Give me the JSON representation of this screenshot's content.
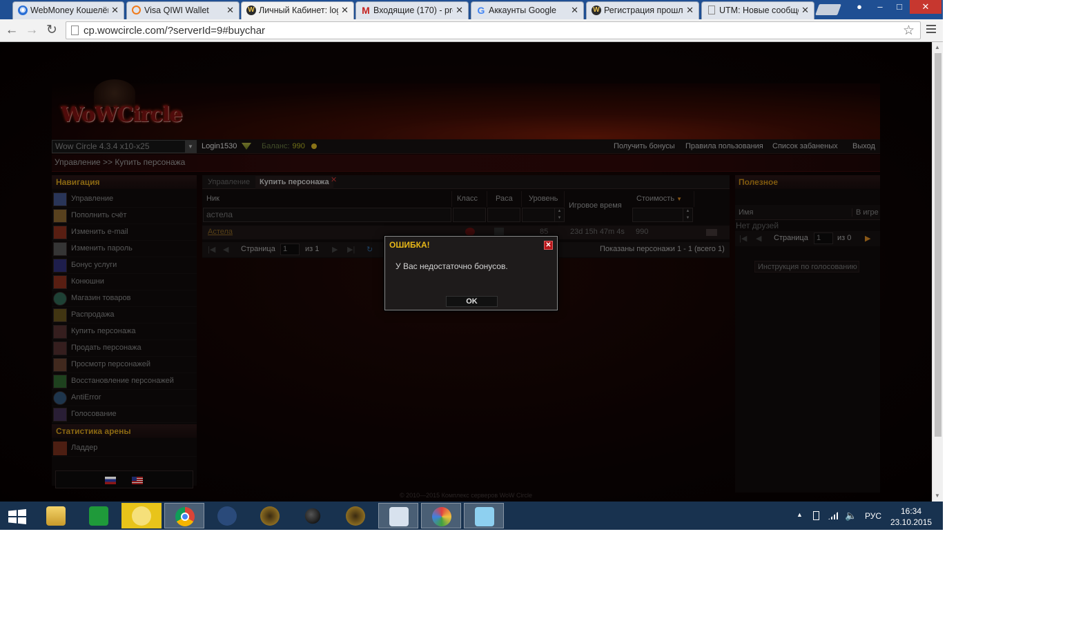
{
  "browser": {
    "tabs": [
      {
        "title": "WebMoney Кошелёк",
        "icon": "webmoney-icon",
        "color": "#2a6fd6"
      },
      {
        "title": "Visa QIWI Wallet",
        "icon": "qiwi-icon",
        "color": "#f07a1a"
      },
      {
        "title": "Личный Кабинет: log",
        "icon": "wowcircle-icon",
        "color": "#2a2a2a"
      },
      {
        "title": "Входящие (170) - pre",
        "icon": "gmail-icon",
        "color": "#c5221f"
      },
      {
        "title": "Аккаунты Google",
        "icon": "google-icon",
        "color": "#4285f4"
      },
      {
        "title": "Регистрация прошла",
        "icon": "wowcircle-icon",
        "color": "#2a2a2a"
      },
      {
        "title": "UTM: Новые сообщен",
        "icon": "page-icon",
        "color": "#888888"
      }
    ],
    "url": "cp.wowcircle.com/?serverId=9#buychar"
  },
  "site": {
    "logo": "WoWCircle",
    "server_select": "Wow Circle 4.3.4 x10-x25",
    "login": "Login1530",
    "balance_label": "Баланс:",
    "balance_value": "990",
    "top_links": [
      "Получить бонусы",
      "Правила пользования",
      "Список забаненых",
      "Выход"
    ],
    "breadcrumb": "Управление >> Купить персонажа",
    "footer": "© 2010—2015 Комплекс серверов WoW Circle"
  },
  "leftnav": {
    "nav_title": "Навигация",
    "items": [
      {
        "label": "Управление",
        "icon": "management-icon",
        "color": "#3a4a7a"
      },
      {
        "label": "Пополнить счёт",
        "icon": "deposit-icon",
        "color": "#7a5a2a"
      },
      {
        "label": "Изменить e-mail",
        "icon": "email-icon",
        "color": "#7a2a1a"
      },
      {
        "label": "Изменить пароль",
        "icon": "password-icon",
        "color": "#4a4a4a"
      },
      {
        "label": "Бонус услуги",
        "icon": "bonus-icon",
        "color": "#2a2a6a"
      },
      {
        "label": "Конюшни",
        "icon": "stable-icon",
        "color": "#7a2a1a"
      },
      {
        "label": "Магазин товаров",
        "icon": "shop-icon",
        "color": "#2a5a4a"
      },
      {
        "label": "Распродажа",
        "icon": "sale-icon",
        "color": "#5a4a1a"
      },
      {
        "label": "Купить персонажа",
        "icon": "buy-character-icon",
        "color": "#4a2a2a"
      },
      {
        "label": "Продать персонажа",
        "icon": "sell-character-icon",
        "color": "#4a2a2a"
      },
      {
        "label": "Просмотр персонажей",
        "icon": "view-characters-icon",
        "color": "#5a3a2a"
      },
      {
        "label": "Восстановление персонажей",
        "icon": "restore-characters-icon",
        "color": "#2a5a2a"
      },
      {
        "label": "AntiError",
        "icon": "antierror-icon",
        "color": "#2a4a6a"
      },
      {
        "label": "Голосование",
        "icon": "vote-icon",
        "color": "#3a2a4a"
      }
    ],
    "arena_title": "Статистика арены",
    "arena_items": [
      {
        "label": "Ладдер",
        "icon": "ladder-icon",
        "color": "#6a2a1a"
      }
    ]
  },
  "center": {
    "tab_manage": "Управление",
    "tab_buy": "Купить персонажа",
    "columns": [
      "Ник",
      "Класс",
      "Раса",
      "Уровень",
      "Игровое время",
      "Стоимость"
    ],
    "sort_indicator": "▼",
    "filter_name": "астела",
    "row": {
      "name": "Астела",
      "level": "85",
      "playtime": "23d 15h 47m 4s",
      "price": "990"
    },
    "pager": {
      "page_label": "Страница",
      "page": "1",
      "of_label": "из 1",
      "summary": "Показаны персонажи 1 - 1 (всего 1)"
    }
  },
  "right": {
    "title": "Полезное",
    "col_name": "Имя",
    "col_ingame": "В игре",
    "no_friends": "Нет друзей",
    "page_label": "Страница",
    "page": "1",
    "of_label": "из 0",
    "vote_instr": "Инструкция по голосованию"
  },
  "dialog": {
    "title": "ОШИБКА!",
    "message": "У Вас недостаточно бонусов.",
    "ok": "OK"
  },
  "taskbar": {
    "language": "РУС",
    "time": "16:34",
    "date": "23.10.2015"
  }
}
